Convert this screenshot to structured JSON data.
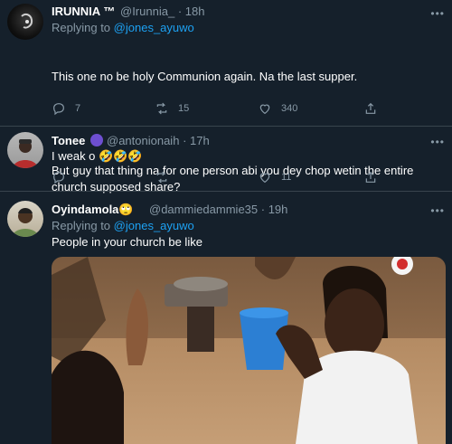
{
  "tweets": [
    {
      "name": "IRUNNIA ™",
      "handle": "@Irunnia_",
      "time": "· 18h",
      "replying_label": "Replying to",
      "replying_handle": "@jones_ayuwo",
      "text_line1": "This one no be holy Communion again. Na the last supper.",
      "text_line2": "But guy that thing na for one person abi you dey chop wetin the entire church supposed share?",
      "replies": "7",
      "retweets": "15",
      "likes": "340"
    },
    {
      "name": "Tonee",
      "handle": "@antonionaih",
      "time": "· 17h",
      "text": "I weak o 🤣🤣🤣",
      "replies": "",
      "retweets": "",
      "likes": "11"
    },
    {
      "name": "Oyindamola",
      "handle": "@dammiedammie35",
      "time": "· 19h",
      "replying_label": "Replying to",
      "replying_handle": "@jones_ayuwo",
      "text": "People in your church be like",
      "emoji": "🙄"
    }
  ],
  "more_label": "•••",
  "icons": [
    "reply-icon",
    "retweet-icon",
    "like-icon",
    "share-icon",
    "more-icon",
    "verified-badge-icon"
  ],
  "colors": {
    "background": "#15202b",
    "text": "#ffffff",
    "secondary": "#8899a6",
    "link": "#1da1f2",
    "divider": "#38444d"
  }
}
